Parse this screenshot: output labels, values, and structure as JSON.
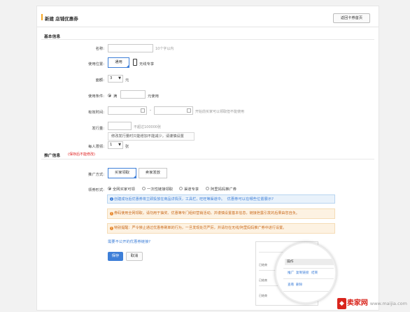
{
  "header": {
    "title": "新建 店铺优惠券",
    "back_button": "返回卡券首页"
  },
  "basic": {
    "section_title": "基本信息",
    "name_label": "名称:",
    "name_hint": "10个字以内",
    "location_label": "使用位置:",
    "location_options": [
      "通用",
      "无线专享"
    ],
    "location_selected": "通用",
    "amount_label": "面额:",
    "amount_value": "3",
    "amount_unit": "元",
    "condition_label": "使用条件:",
    "condition_prefix": "满",
    "condition_suffix": "元使用",
    "period_label": "有效时间:",
    "period_sep": "-",
    "period_hint": "开始前买家可以领取但不能使用",
    "qty_label": "发行量:",
    "qty_hint": "不超过100000张",
    "qty_tip": "修改发行量时只能增加不能减少，请谨慎设置",
    "limit_label": "每人限领:",
    "limit_value": "1",
    "limit_unit": "张"
  },
  "promo": {
    "section_title": "推广信息",
    "section_note": "(保存后不能修改)",
    "method_label": "推广方式:",
    "method_options": [
      "买家领取",
      "卖家发放"
    ],
    "method_selected": "买家领取",
    "receive_label": "领券形式:",
    "receive_options": [
      "全网买家可领",
      "一次性链接领取",
      "渠道专享",
      "阿里妈妈推广券"
    ],
    "receive_selected": "全网买家可领",
    "info_alert": "创建成功后优惠券将立即投放在商品详情页，工具栏，旺旺等渠道中。",
    "info_link": "优惠券可以在哪些位置展示?",
    "warn_alert_1": "券码使用全网领取，请勿用于抽奖、优惠等专门组织营销活动，并谨慎设置基本信息，链接泄露引发的后果由您自负。",
    "warn_alert_2": "特别提醒：严令禁止通过优惠券刷单的行为，一旦发现处罚严厉，并请勿在无线/阿里妈妈推广券中进行设置。",
    "hidden_link": "需要不公开的优惠券链接?"
  },
  "actions": {
    "save": "保存",
    "cancel": "取消"
  },
  "preview": {
    "header": "操作",
    "links_row1": [
      "推广",
      "复制链接",
      "结束"
    ],
    "links_row2": [
      "查看",
      "删除"
    ],
    "mini_rows": [
      "已结束",
      "已结束",
      "已结束"
    ]
  },
  "watermark": {
    "logo": "卖家网",
    "url": "www.maijia.com"
  },
  "colors": {
    "accent": "#3e7fd8",
    "warning": "#e8892f",
    "note_red": "#e02020",
    "brand_red": "#d9251d"
  }
}
